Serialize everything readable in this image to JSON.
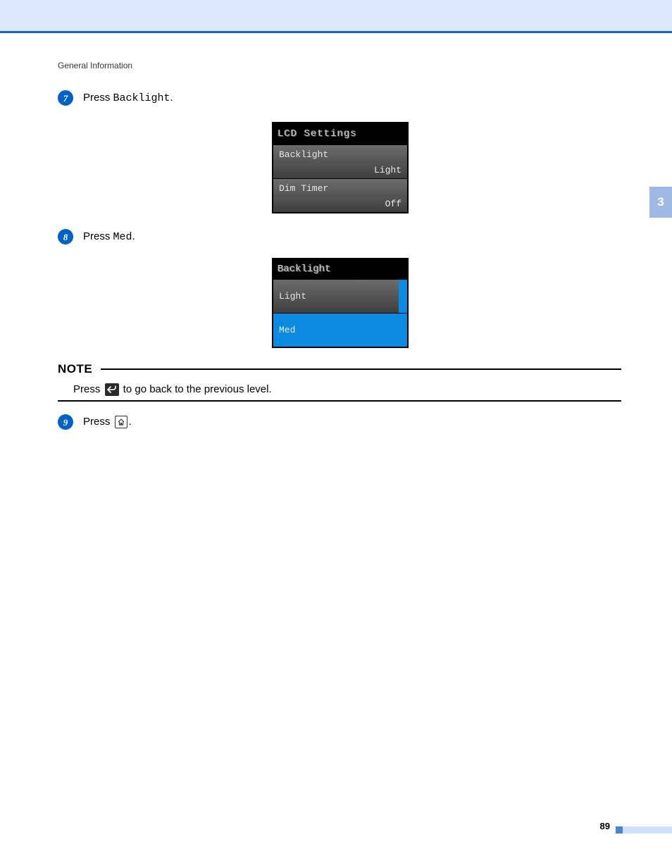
{
  "header": {
    "section": "General Information"
  },
  "steps": {
    "s7": {
      "num": "7",
      "prefix": "Press ",
      "code": "Backlight",
      "suffix": "."
    },
    "s8": {
      "num": "8",
      "prefix": "Press ",
      "code": "Med",
      "suffix": "."
    },
    "s9": {
      "num": "9",
      "prefix": "Press ",
      "suffix": "."
    }
  },
  "lcd1": {
    "title": "LCD Settings",
    "rows": [
      {
        "label": "Backlight",
        "value": "Light"
      },
      {
        "label": "Dim Timer",
        "value": "Off"
      }
    ]
  },
  "lcd2": {
    "title": "Backlight",
    "items": [
      {
        "label": "Light",
        "selected": false
      },
      {
        "label": "Med",
        "selected": true
      }
    ]
  },
  "note": {
    "heading": "NOTE",
    "before": "Press ",
    "after": " to go back to the previous level."
  },
  "sideTab": "3",
  "pageNumber": "89"
}
